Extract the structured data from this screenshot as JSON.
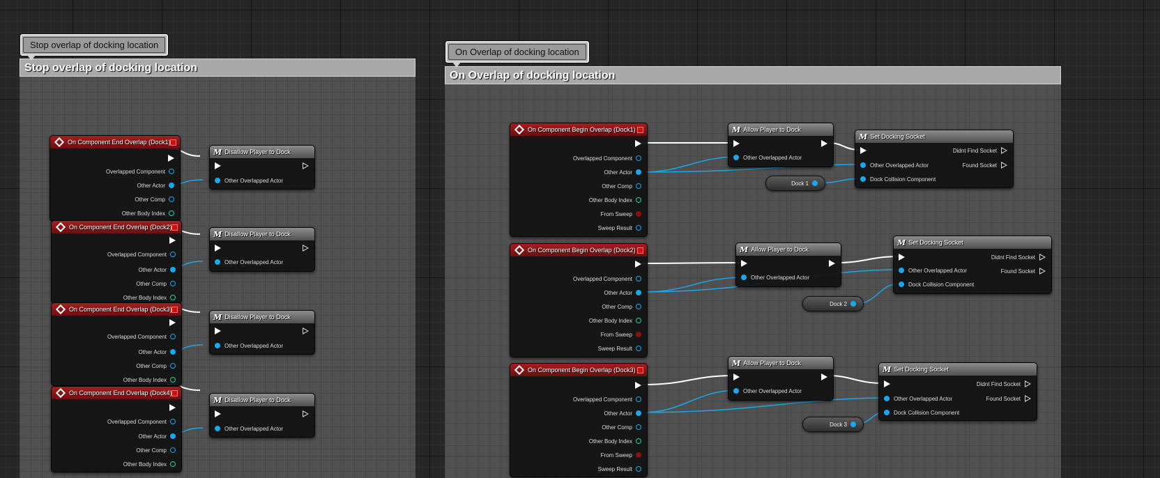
{
  "comments": [
    {
      "bubble": "Stop overlap of docking location",
      "header": "Stop overlap of docking location"
    },
    {
      "bubble": "On Overlap of docking location",
      "header": "On Overlap of docking location"
    }
  ],
  "end_overlap_events": [
    {
      "title": "On Component End Overlap (Dock1)",
      "pins": [
        "Overlapped Component",
        "Other Actor",
        "Other Comp",
        "Other Body Index"
      ]
    },
    {
      "title": "On Component End Overlap (Dock2)",
      "pins": [
        "Overlapped Component",
        "Other Actor",
        "Other Comp",
        "Other Body Index"
      ]
    },
    {
      "title": "On Component End Overlap (Dock3)",
      "pins": [
        "Overlapped Component",
        "Other Actor",
        "Other Comp",
        "Other Body Index"
      ]
    },
    {
      "title": "On Component End Overlap (Dock4)",
      "pins": [
        "Overlapped Component",
        "Other Actor",
        "Other Comp",
        "Other Body Index"
      ]
    }
  ],
  "disallow_nodes": [
    {
      "title": "Disallow Player to Dock",
      "input": "Other Overlapped Actor"
    },
    {
      "title": "Disallow Player to Dock",
      "input": "Other Overlapped Actor"
    },
    {
      "title": "Disallow Player to Dock",
      "input": "Other Overlapped Actor"
    },
    {
      "title": "Disallow Player to Dock",
      "input": "Other Overlapped Actor"
    }
  ],
  "begin_overlap_events": [
    {
      "title": "On Component Begin Overlap (Dock1)",
      "pins": [
        "Overlapped Component",
        "Other Actor",
        "Other Comp",
        "Other Body Index",
        "From Sweep",
        "Sweep Result"
      ]
    },
    {
      "title": "On Component Begin Overlap (Dock2)",
      "pins": [
        "Overlapped Component",
        "Other Actor",
        "Other Comp",
        "Other Body Index",
        "From Sweep",
        "Sweep Result"
      ]
    },
    {
      "title": "On Component Begin Overlap (Dock3)",
      "pins": [
        "Overlapped Component",
        "Other Actor",
        "Other Comp",
        "Other Body Index",
        "From Sweep",
        "Sweep Result"
      ]
    }
  ],
  "allow_nodes": [
    {
      "title": "Allow Player to Dock",
      "input": "Other Overlapped Actor"
    },
    {
      "title": "Allow Player to Dock",
      "input": "Other Overlapped Actor"
    },
    {
      "title": "Allow Player to Dock",
      "input": "Other Overlapped Actor"
    }
  ],
  "socket_nodes": [
    {
      "title": "Set Docking Socket",
      "inputs": [
        "Other Overlapped Actor",
        "Dock Collision Component"
      ],
      "outputs": [
        "Didnt Find Socket",
        "Found Socket"
      ]
    },
    {
      "title": "Set Docking Socket",
      "inputs": [
        "Other Overlapped Actor",
        "Dock Collision Component"
      ],
      "outputs": [
        "Didnt Find Socket",
        "Found Socket"
      ]
    },
    {
      "title": "Set Docking Socket",
      "inputs": [
        "Other Overlapped Actor",
        "Dock Collision Component"
      ],
      "outputs": [
        "Didnt Find Socket",
        "Found Socket"
      ]
    }
  ],
  "dock_vars": [
    "Dock 1",
    "Dock 2",
    "Dock 3"
  ],
  "colors": {
    "exec_wire": "#ffffff",
    "object_wire": "#1aa7ec",
    "event_header": "#a51e1e",
    "function_header": "#7a7a7a"
  }
}
